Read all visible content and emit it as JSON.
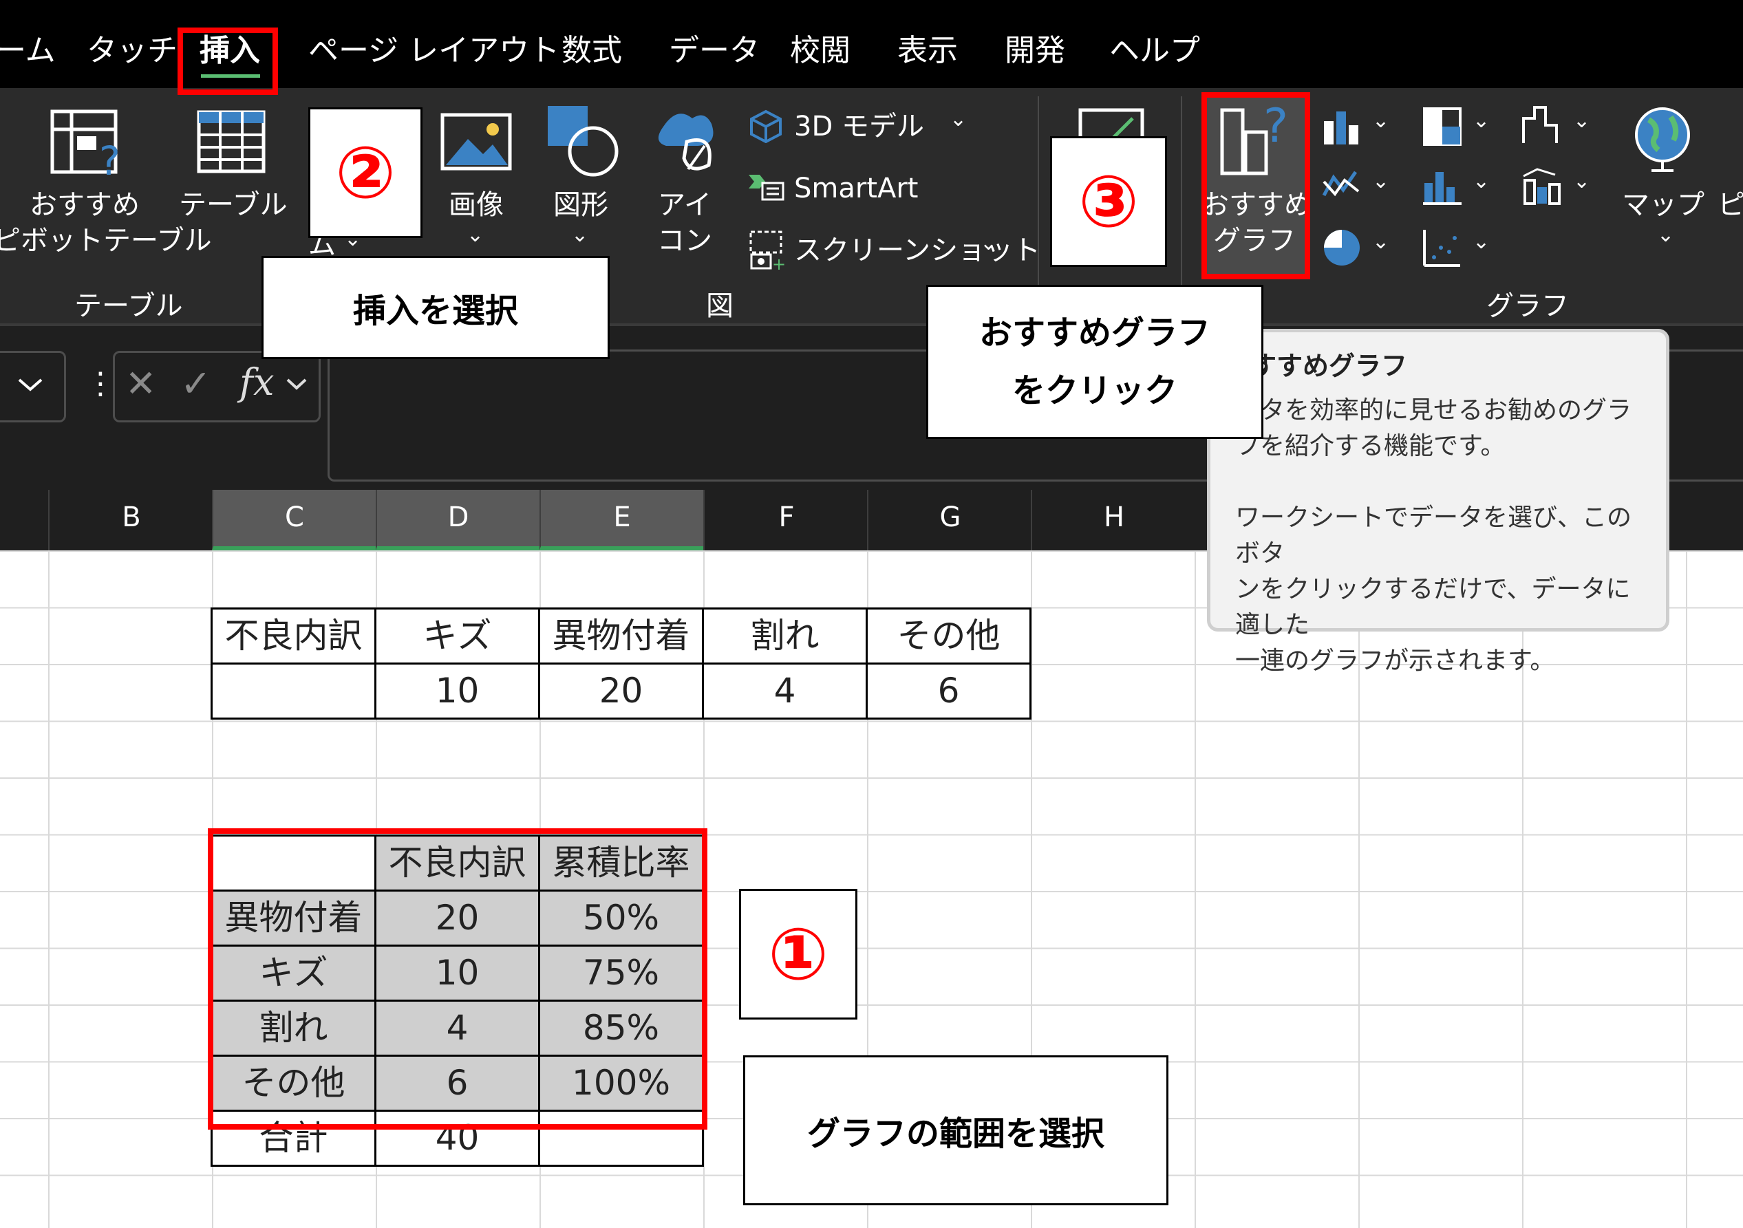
{
  "tabs": [
    "ーム",
    "タッチ",
    "挿入",
    "ページ レイアウト",
    "数式",
    "データ",
    "校閲",
    "表示",
    "開発",
    "ヘルプ"
  ],
  "ribbon": {
    "pivot_line1": "おすすめ",
    "pivot_line2": "ピボットテーブル",
    "table_label": "テーブル",
    "partial_label": "ム",
    "image_label": "画像",
    "shape_label": "図形",
    "icon_line1": "アイ",
    "icon_line2": "コン",
    "model3d_label": "3D モデル",
    "smartart_label": "SmartArt",
    "screenshot_label": "スクリーンショット",
    "recommended_chart_line1": "おすすめ",
    "recommended_chart_line2": "グラフ",
    "map_label": "マップ",
    "partial_right": "ピ",
    "group_table": "テーブル",
    "group_figure": "図",
    "group_chart": "グラフ"
  },
  "formula": {
    "cancel": "✕",
    "enter": "✓",
    "fx": "fx"
  },
  "columns": [
    "B",
    "C",
    "D",
    "E",
    "F",
    "G",
    "H"
  ],
  "defects_table": {
    "headers": [
      "不良内訳",
      "キズ",
      "異物付着",
      "割れ",
      "その他"
    ],
    "values": [
      "",
      "10",
      "20",
      "4",
      "6"
    ]
  },
  "pareto_table": {
    "headers": [
      "",
      "不良内訳",
      "累積比率"
    ],
    "rows": [
      [
        "異物付着",
        "20",
        "50%"
      ],
      [
        "キズ",
        "10",
        "75%"
      ],
      [
        "割れ",
        "4",
        "85%"
      ],
      [
        "その他",
        "6",
        "100%"
      ]
    ],
    "total": [
      "合計",
      "40",
      ""
    ]
  },
  "annotations": {
    "step1_num": "①",
    "step2_num": "②",
    "step3_num": "③",
    "step1_text": "グラフの範囲を選択",
    "step2_text": "挿入を選択",
    "step3_line1": "おすすめグラフ",
    "step3_line2": "をクリック"
  },
  "tooltip": {
    "title": "すすめグラフ",
    "para1": [
      "ータを効率的に見せるお勧めのグラ",
      "フを紹介する機能です。"
    ],
    "para2": [
      "ワークシートでデータを選び、このボタ",
      "ンをクリックするだけで、データに適した",
      "一連のグラフが示されます。"
    ]
  },
  "colors": {
    "highlight_red": "#ff0000",
    "selection_green": "#39a05a",
    "chart_blue": "#3b82c4"
  }
}
